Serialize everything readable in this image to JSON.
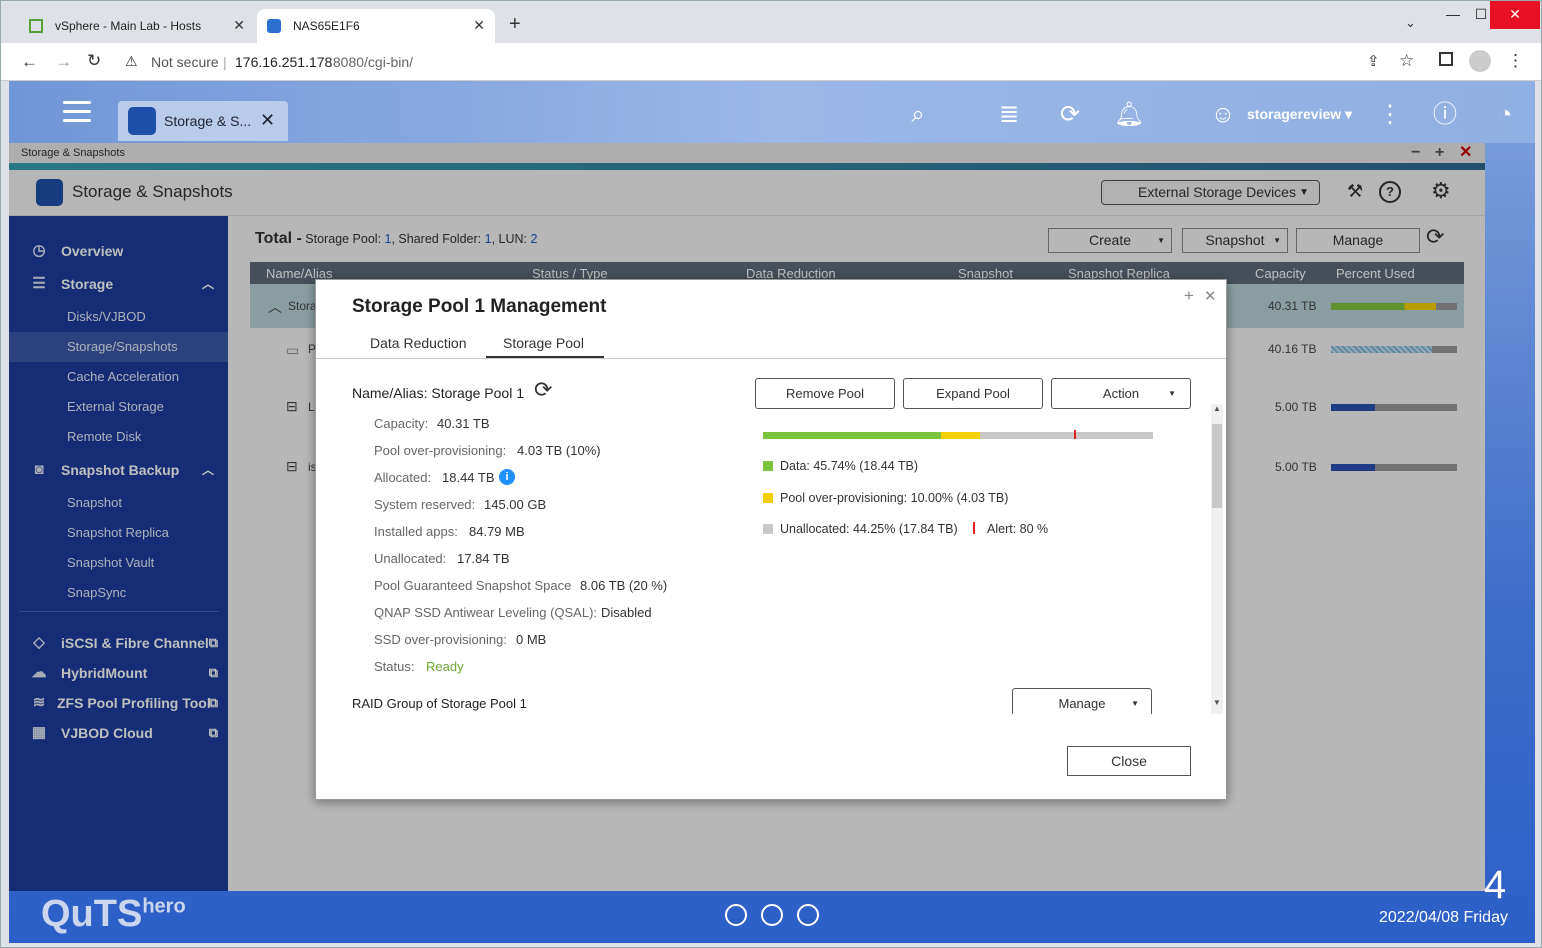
{
  "browser": {
    "tabs": [
      {
        "label": "vSphere - Main Lab - Hosts"
      },
      {
        "label": "NAS65E1F6"
      }
    ],
    "security": "Not secure",
    "url_host": "176.16.251.178",
    "url_rest": ":8080/cgi-bin/"
  },
  "qts": {
    "app_tab_label": "Storage & S...",
    "username": "storagereview",
    "brand": "QuTS",
    "brand_suffix": "hero",
    "clock_partial": "4",
    "date": "2022/04/08 Friday"
  },
  "window": {
    "title": "Storage & Snapshots",
    "app_title": "Storage & Snapshots",
    "external_devices_label": "External Storage Devices"
  },
  "sidebar": {
    "overview": "Overview",
    "storage": "Storage",
    "storage_items": [
      "Disks/VJBOD",
      "Storage/Snapshots",
      "Cache Acceleration",
      "External Storage",
      "Remote Disk"
    ],
    "snapshot_backup": "Snapshot Backup",
    "snapshot_items": [
      "Snapshot",
      "Snapshot Replica",
      "Snapshot Vault",
      "SnapSync"
    ],
    "links": [
      "iSCSI & Fibre Channel",
      "HybridMount",
      "ZFS Pool Profiling Tool",
      "VJBOD Cloud"
    ]
  },
  "main": {
    "total_label": "Total -",
    "pool_label": "Storage Pool:",
    "pool_count": "1",
    "folder_label": ", Shared Folder:",
    "folder_count": "1",
    "lun_label": ", LUN:",
    "lun_count": "2",
    "create": "Create",
    "snapshot": "Snapshot",
    "manage": "Manage",
    "columns": [
      "Name/Alias",
      "Status / Type",
      "Data Reduction",
      "Snapshot",
      "Snapshot Replica",
      "Capacity",
      "Percent Used"
    ],
    "rows": [
      {
        "name": "Stora",
        "capacity": "40.31 TB",
        "used_fraction": 0.83
      },
      {
        "name": "P",
        "capacity": "40.16 TB",
        "used_fraction": 0.8
      },
      {
        "name": "L",
        "capacity": "5.00 TB",
        "used_fraction": 0.35
      },
      {
        "name": "is",
        "capacity": "5.00 TB",
        "used_fraction": 0.35
      }
    ]
  },
  "dialog": {
    "title": "Storage Pool 1 Management",
    "tabs": [
      "Data Reduction",
      "Storage Pool"
    ],
    "active_tab": "Storage Pool",
    "name_alias": "Name/Alias: Storage Pool 1",
    "buttons": {
      "remove": "Remove Pool",
      "expand": "Expand Pool",
      "action": "Action",
      "close": "Close",
      "raid_manage": "Manage"
    },
    "fields": [
      {
        "label": "Capacity:",
        "value": "40.31 TB"
      },
      {
        "label": "Pool over-provisioning:",
        "value": "4.03 TB (10%)"
      },
      {
        "label": "Allocated:",
        "value": "18.44 TB"
      },
      {
        "label": "System reserved:",
        "value": "145.00 GB"
      },
      {
        "label": "Installed apps:",
        "value": "84.79 MB"
      },
      {
        "label": "Unallocated:",
        "value": "17.84 TB"
      },
      {
        "label": "Pool Guaranteed Snapshot Space",
        "value": "8.06 TB (20 %)"
      },
      {
        "label": "QNAP SSD Antiwear Leveling (QSAL):",
        "value": "Disabled"
      },
      {
        "label": "SSD over-provisioning:",
        "value": "0 MB"
      },
      {
        "label": "Status:",
        "value": "Ready"
      }
    ],
    "raid_group": "RAID Group of Storage Pool 1",
    "usage": {
      "data_fraction": 0.4574,
      "overprov_fraction": 0.1,
      "alert_fraction": 0.8
    },
    "legend": {
      "data": "Data: 45.74% (18.44 TB)",
      "overprov": "Pool over-provisioning: 10.00% (4.03 TB)",
      "unallocated": "Unallocated: 44.25% (17.84 TB)",
      "alert": "Alert: 80 %"
    },
    "colors": {
      "data": "#7cc33e",
      "overprov": "#f5d000",
      "unallocated": "#c8c8c8",
      "alert": "#e02020",
      "ready": "#6aa833"
    }
  }
}
